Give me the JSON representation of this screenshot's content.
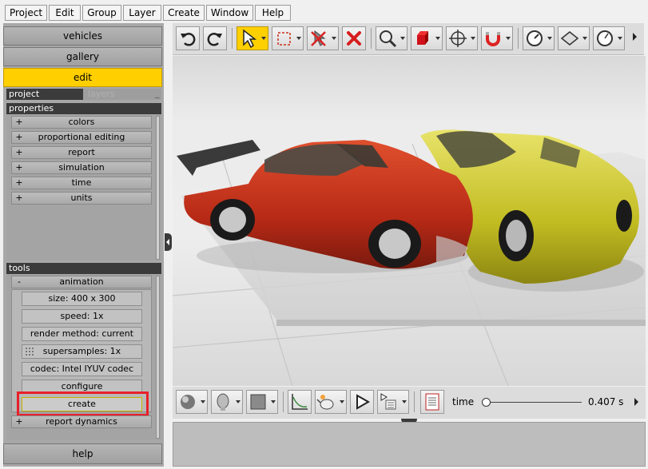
{
  "menu": [
    "Project",
    "Edit",
    "Group",
    "Layer",
    "Create",
    "Window",
    "Help"
  ],
  "left": {
    "buttons": {
      "vehicles": "vehicles",
      "gallery": "gallery",
      "edit": "edit",
      "help": "help"
    },
    "tabs": {
      "project": "project",
      "layers": "layers"
    },
    "properties": {
      "title": "properties",
      "items": [
        {
          "sign": "+",
          "label": "colors"
        },
        {
          "sign": "+",
          "label": "proportional editing"
        },
        {
          "sign": "+",
          "label": "report"
        },
        {
          "sign": "+",
          "label": "simulation"
        },
        {
          "sign": "+",
          "label": "time"
        },
        {
          "sign": "+",
          "label": "units"
        }
      ]
    },
    "tools": {
      "title": "tools",
      "animation": {
        "sign": "-",
        "label": "animation"
      },
      "buttons": [
        "size: 400 x 300",
        "speed: 1x",
        "render method: current",
        "supersamples: 1x",
        "codec: Intel IYUV codec",
        "configure",
        "create"
      ],
      "report_dynamics": {
        "sign": "+",
        "label": "report dynamics"
      }
    }
  },
  "toolbar_icons": [
    "undo-icon",
    "redo-icon",
    "select-arrow-icon",
    "box-select-icon",
    "clear-icon",
    "delete-icon",
    "zoom-icon",
    "cube-icon",
    "move-icon",
    "magnet-icon",
    "dial-icon",
    "plane-icon",
    "gauge-icon"
  ],
  "bottom": {
    "time_label": "time",
    "time_value": "0.407 s",
    "time_fraction": 0.0
  },
  "colors": {
    "accent": "#ffcf00",
    "highlight": "#e8202a",
    "red_car": "#c8321c",
    "yellow_car": "#c9c62a"
  }
}
